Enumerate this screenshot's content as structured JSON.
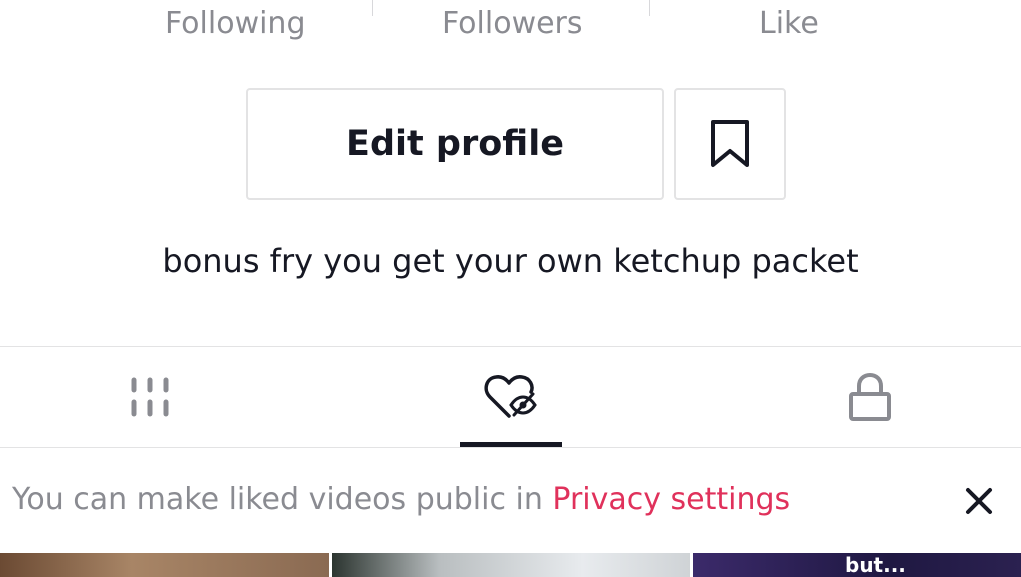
{
  "stats": {
    "following_label": "Following",
    "followers_label": "Followers",
    "like_label": "Like"
  },
  "profile": {
    "edit_button_label": "Edit profile",
    "bookmark_icon": "bookmark-icon",
    "bio": "bonus fry you get your own ketchup packet"
  },
  "tabs": {
    "items": [
      {
        "name": "videos",
        "icon": "grid-icon",
        "active": false
      },
      {
        "name": "liked",
        "icon": "hidden-heart-icon",
        "active": true
      },
      {
        "name": "private",
        "icon": "lock-icon",
        "active": false
      }
    ]
  },
  "notice": {
    "text": "You can make liked videos public in ",
    "link_text": "Privacy settings",
    "close_icon": "close-icon"
  },
  "thumbnails": [
    {
      "caption": ""
    },
    {
      "caption": ""
    },
    {
      "caption": "but..."
    }
  ],
  "colors": {
    "text_primary": "#161823",
    "text_secondary": "#8a8b91",
    "accent_link": "#e0315b",
    "border": "#e3e3e4"
  }
}
